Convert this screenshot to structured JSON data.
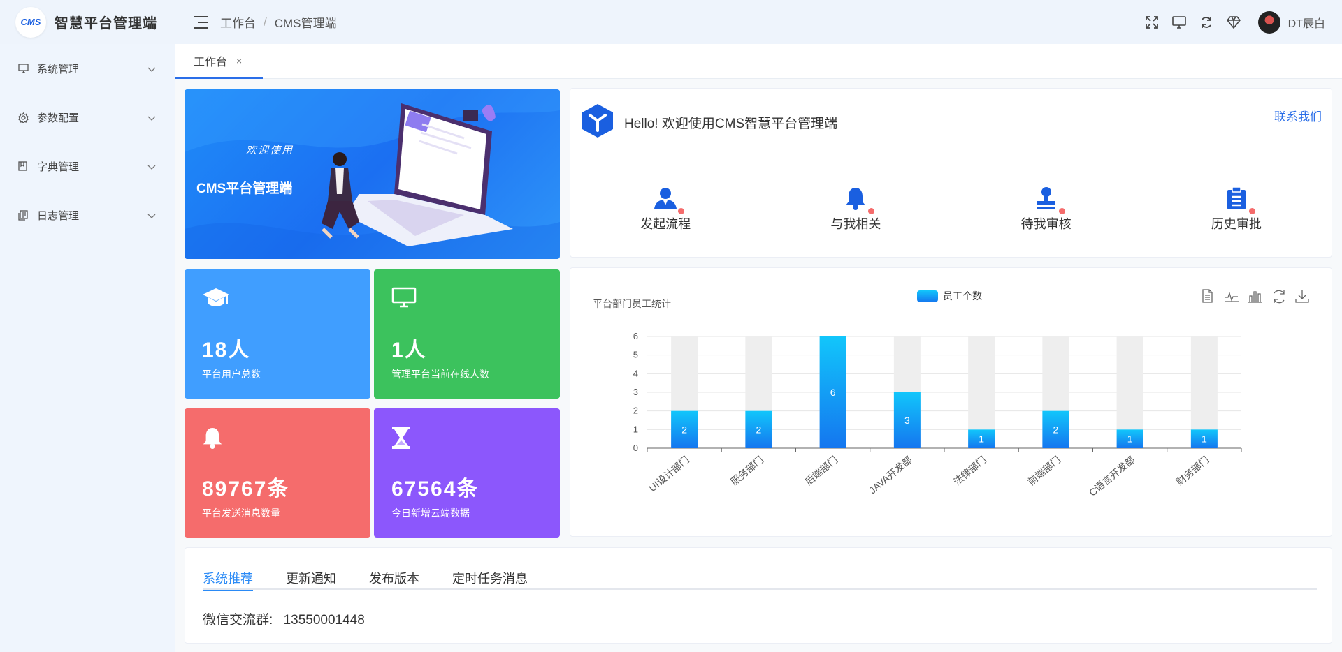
{
  "app": {
    "logo_text": "CMS",
    "name": "智慧平台管理端"
  },
  "breadcrumb": [
    "工作台",
    "CMS管理端"
  ],
  "breadcrumb_sep": "/",
  "user": {
    "name": "DT辰白"
  },
  "sidebar": {
    "items": [
      {
        "label": "系统管理",
        "icon": "monitor-icon"
      },
      {
        "label": "参数配置",
        "icon": "settings-icon"
      },
      {
        "label": "字典管理",
        "icon": "book-icon"
      },
      {
        "label": "日志管理",
        "icon": "log-icon"
      }
    ]
  },
  "tabs": [
    {
      "label": "工作台",
      "close": "×"
    }
  ],
  "banner": {
    "welcome": "欢迎使用",
    "title": "CMS平台管理端"
  },
  "hello": {
    "text": "Hello! 欢迎使用CMS智慧平台管理端",
    "contact": "联系我们"
  },
  "quick_actions": [
    {
      "label": "发起流程",
      "icon": "user-icon"
    },
    {
      "label": "与我相关",
      "icon": "bell-icon"
    },
    {
      "label": "待我审核",
      "icon": "stamp-icon"
    },
    {
      "label": "历史审批",
      "icon": "clipboard-icon"
    }
  ],
  "stats": [
    {
      "value": "18人",
      "label": "平台用户总数",
      "color": "#409eff",
      "icon": "graduation-cap-icon"
    },
    {
      "value": "1人",
      "label": "管理平台当前在线人数",
      "color": "#3cc25d",
      "icon": "monitor-icon"
    },
    {
      "value": "89767条",
      "label": "平台发送消息数量",
      "color": "#f56c6c",
      "icon": "bell-icon"
    },
    {
      "value": "67564条",
      "label": "今日新增云端数据",
      "color": "#8c57fc",
      "icon": "hourglass-icon"
    }
  ],
  "chart_data": {
    "type": "bar",
    "title": "平台部门员工统计",
    "legend": [
      "员工个数"
    ],
    "legend_position": "top-center",
    "categories": [
      "UI设计部门",
      "服务部门",
      "后端部门",
      "JAVA开发部",
      "法律部门",
      "前端部门",
      "C语言开发部",
      "财务部门"
    ],
    "series": [
      {
        "name": "员工个数",
        "values": [
          2,
          2,
          6,
          3,
          1,
          2,
          1,
          1
        ]
      }
    ],
    "ylim": [
      0,
      6
    ],
    "yticks": [
      0,
      1,
      2,
      3,
      4,
      5,
      6
    ],
    "background_bars": true,
    "grid": true,
    "colors": {
      "bar_top": "#12c6fb",
      "bar_bottom": "#1476ef",
      "bar_bg": "#eeeeee"
    }
  },
  "chart_tools": [
    "data-view-icon",
    "line-chart-icon",
    "bar-chart-icon",
    "refresh-icon",
    "download-icon"
  ],
  "bottom_tabs": [
    "系统推荐",
    "更新通知",
    "发布版本",
    "定时任务消息"
  ],
  "active_bottom_tab": 0,
  "wechat": {
    "label": "微信交流群:",
    "number": "13550001448"
  }
}
